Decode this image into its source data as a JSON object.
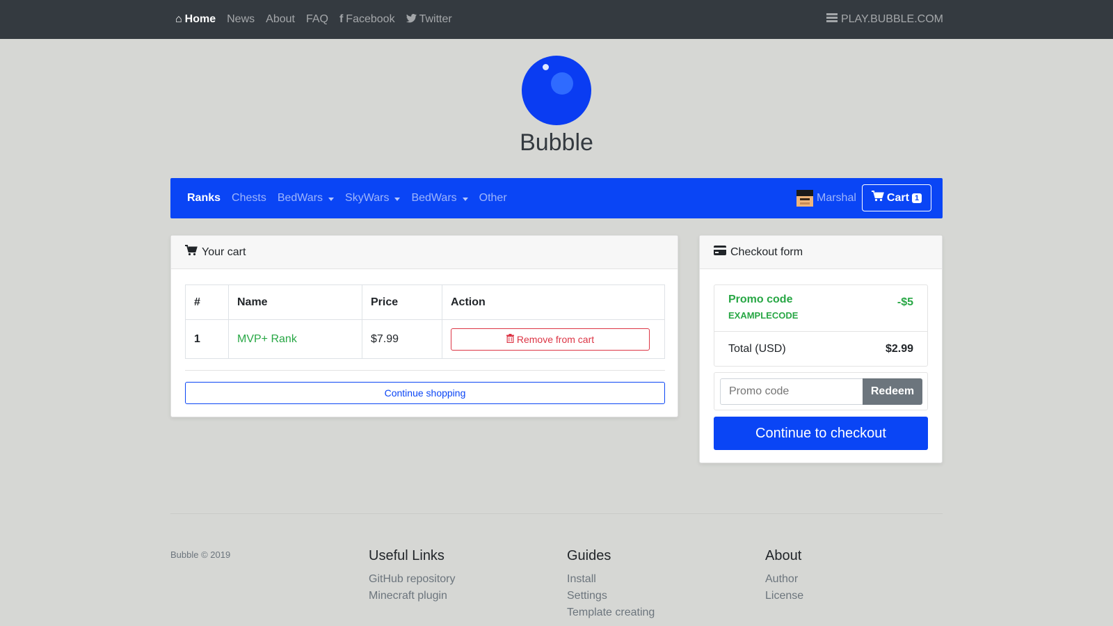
{
  "topnav": {
    "items": [
      {
        "label": "Home",
        "icon": "home-icon",
        "active": true
      },
      {
        "label": "News"
      },
      {
        "label": "About"
      },
      {
        "label": "FAQ"
      },
      {
        "label": "Facebook",
        "icon": "facebook-icon"
      },
      {
        "label": "Twitter",
        "icon": "twitter-icon"
      }
    ],
    "server": "PLAY.BUBBLE.COM"
  },
  "brand": {
    "name": "Bubble"
  },
  "storenav": {
    "items": [
      {
        "label": "Ranks",
        "active": true
      },
      {
        "label": "Chests"
      },
      {
        "label": "BedWars",
        "dropdown": true
      },
      {
        "label": "SkyWars",
        "dropdown": true
      },
      {
        "label": "BedWars",
        "dropdown": true
      },
      {
        "label": "Other"
      }
    ],
    "user": "Marshal",
    "cart_label": "Cart",
    "cart_count": "1"
  },
  "cart": {
    "title": "Your cart",
    "columns": [
      "#",
      "Name",
      "Price",
      "Action"
    ],
    "rows": [
      {
        "num": "1",
        "name": "MVP+ Rank",
        "price": "$7.99",
        "action": "Remove from cart"
      }
    ],
    "continue_label": "Continue shopping"
  },
  "checkout": {
    "title": "Checkout form",
    "promo_title": "Promo code",
    "promo_code": "EXAMPLECODE",
    "promo_value": "-$5",
    "total_label": "Total (USD)",
    "total_value": "$2.99",
    "promo_placeholder": "Promo code",
    "redeem_label": "Redeem",
    "checkout_label": "Continue to checkout"
  },
  "footer": {
    "copyright": "Bubble © 2019",
    "columns": [
      {
        "title": "Useful Links",
        "links": [
          "GitHub repository",
          "Minecraft plugin"
        ]
      },
      {
        "title": "Guides",
        "links": [
          "Install",
          "Settings",
          "Template creating"
        ]
      },
      {
        "title": "About",
        "links": [
          "Author",
          "License"
        ]
      }
    ]
  },
  "colors": {
    "primary": "#0a45f5",
    "success": "#28a745",
    "danger": "#dc3545",
    "topbar": "#343a40",
    "background": "#d6d7d4"
  }
}
